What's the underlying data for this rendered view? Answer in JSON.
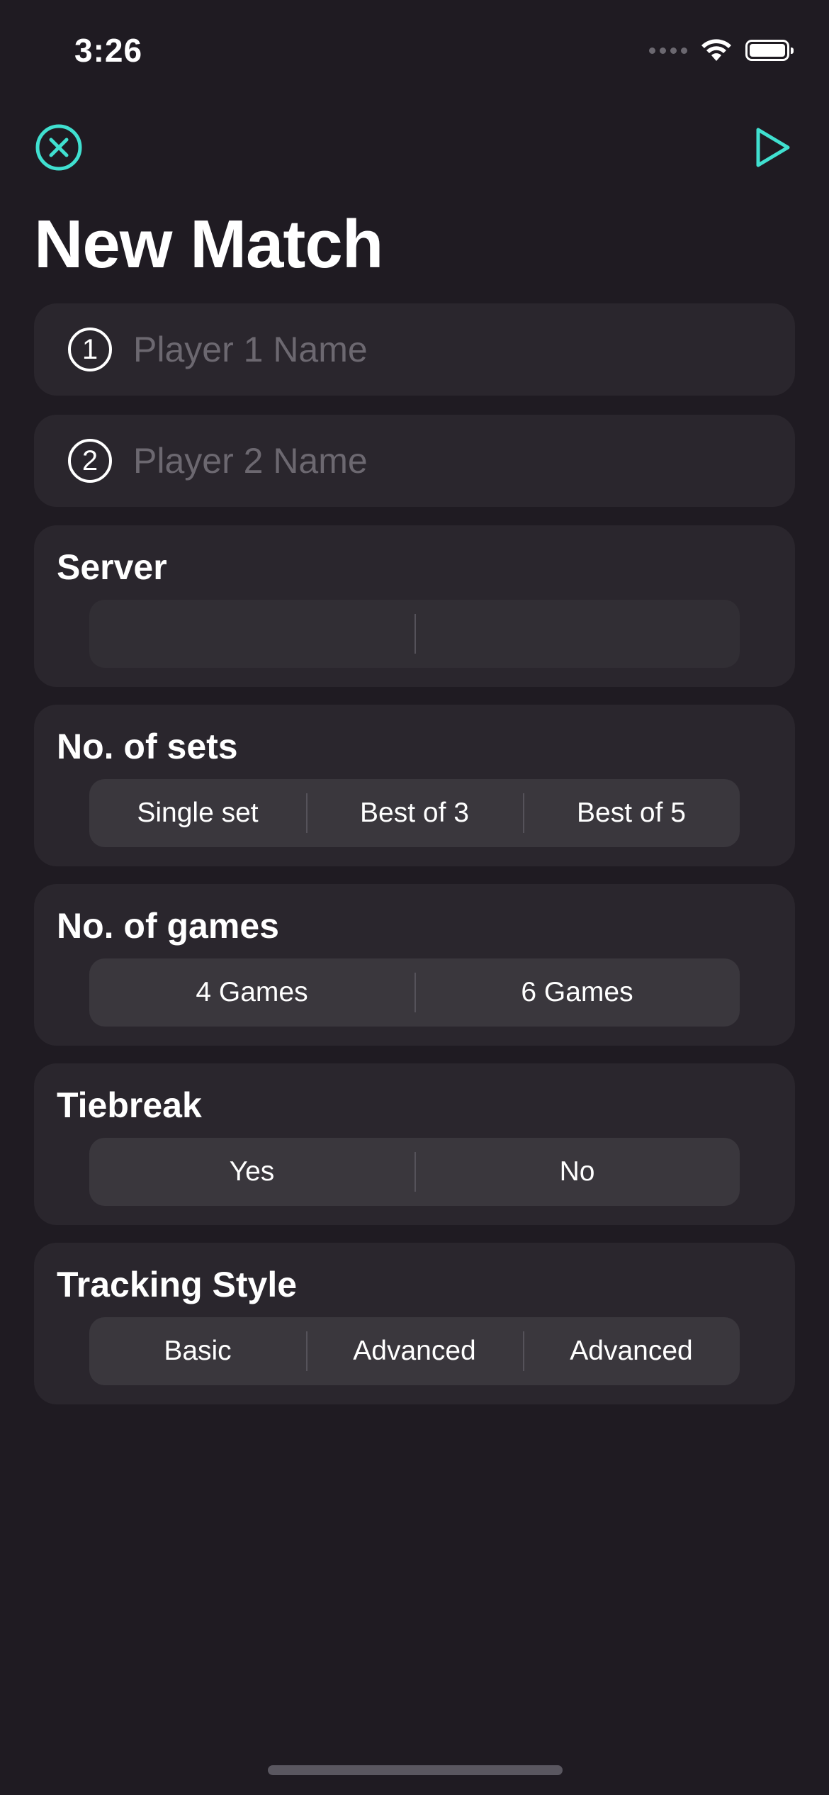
{
  "status_bar": {
    "time": "3:26",
    "icons": [
      "signal-icon",
      "wifi-icon",
      "battery-icon"
    ]
  },
  "nav": {
    "close_icon": "close-circle-icon",
    "play_icon": "play-icon",
    "accent_color": "#40e0d0"
  },
  "title": "New Match",
  "players": [
    {
      "number": "1",
      "value": "",
      "placeholder": "Player 1 Name"
    },
    {
      "number": "2",
      "value": "",
      "placeholder": "Player 2 Name"
    }
  ],
  "server": {
    "label": "Server",
    "options": [
      "",
      ""
    ]
  },
  "sets": {
    "label": "No. of sets",
    "options": [
      "Single set",
      "Best of 3",
      "Best of 5"
    ]
  },
  "games": {
    "label": "No. of games",
    "options": [
      "4 Games",
      "6 Games"
    ]
  },
  "tiebreak": {
    "label": "Tiebreak",
    "options": [
      "Yes",
      "No"
    ]
  },
  "tracking": {
    "label": "Tracking Style",
    "options": [
      "Basic",
      "Advanced",
      "Advanced"
    ]
  }
}
